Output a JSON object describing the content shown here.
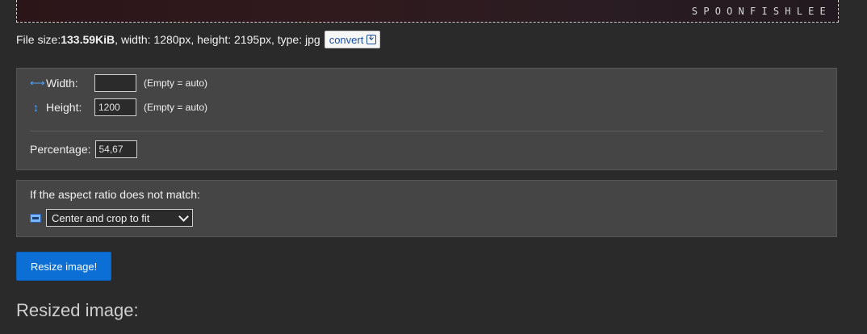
{
  "preview": {
    "watermark": "SPOONFISHLEE"
  },
  "file_info": {
    "size_label": "File size: ",
    "size_value": "133.59KiB",
    "details": ", width: 1280px, height: 2195px, type: jpg",
    "convert_label": "convert"
  },
  "dimensions": {
    "width_label": "Width:",
    "width_value": "",
    "width_hint": "(Empty = auto)",
    "height_label": "Height:",
    "height_value": "1200",
    "height_hint": "(Empty = auto)",
    "percentage_label": "Percentage:",
    "percentage_value": "54,67"
  },
  "aspect": {
    "label": "If the aspect ratio does not match:",
    "selected_option": "Center and crop to fit"
  },
  "actions": {
    "resize_label": "Resize image!"
  },
  "result": {
    "title": "Resized image:"
  },
  "colors": {
    "accent": "#0b6fd6",
    "icon": "#4fa3ff",
    "panel": "#454545",
    "background": "#2a2a2a"
  }
}
